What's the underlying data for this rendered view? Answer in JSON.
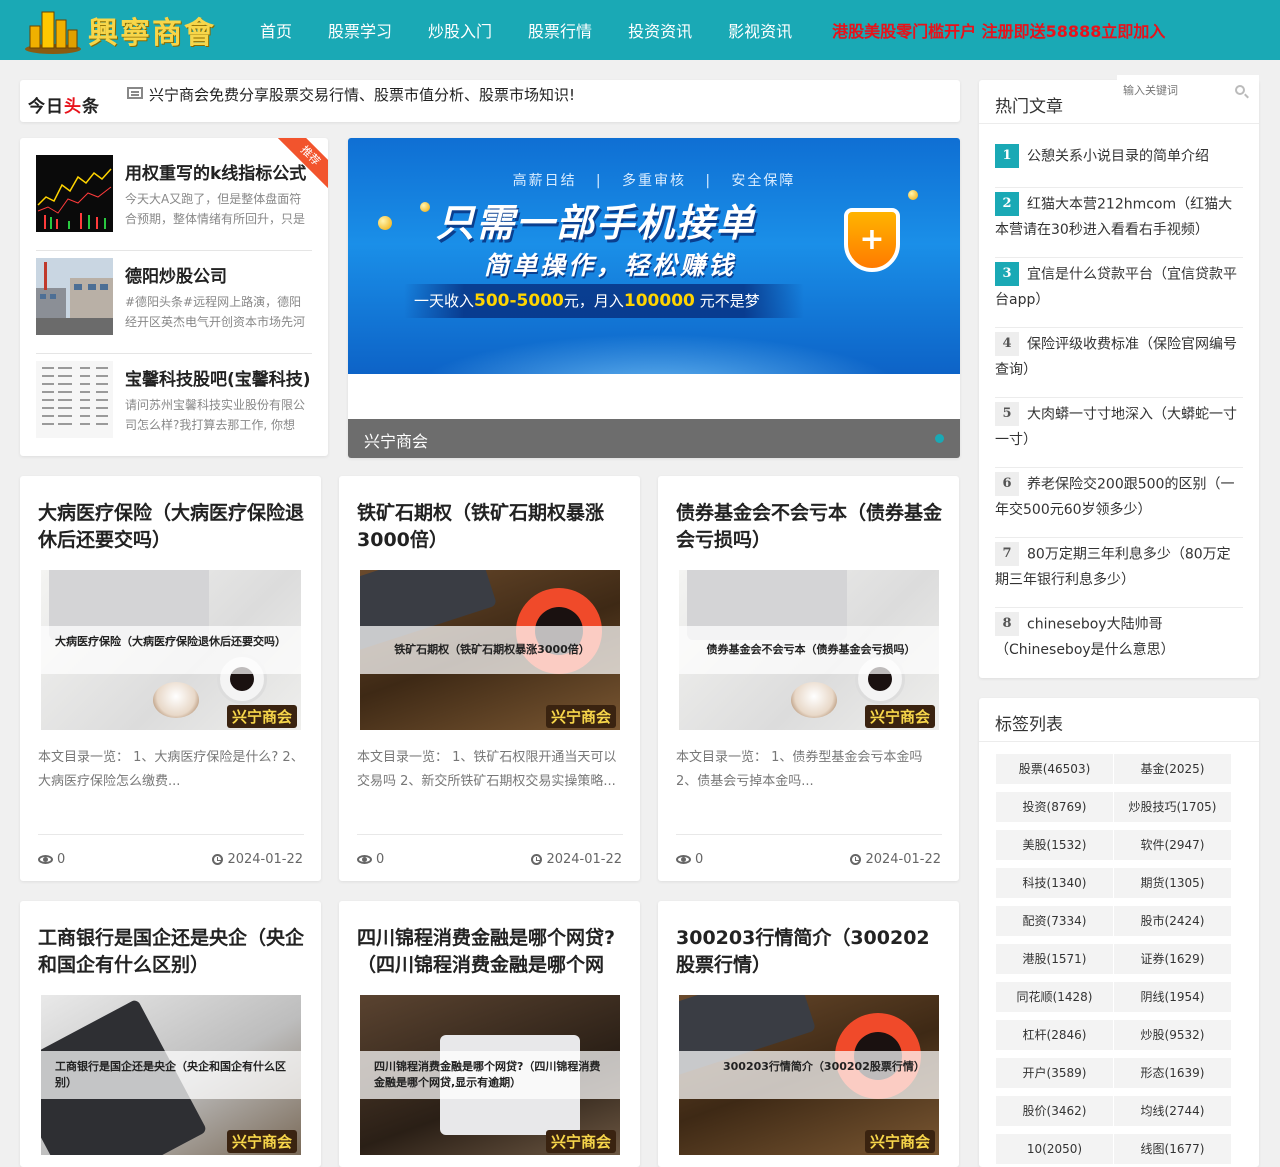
{
  "header": {
    "logo_text": "興寧商會",
    "nav": [
      "首页",
      "股票学习",
      "炒股入门",
      "股票行情",
      "投资资讯",
      "影视资讯"
    ],
    "promo": "港股美股零门槛开户 注册即送58888立即加入",
    "colors": {
      "bar": "#1aa9b5",
      "promo": "#e8121b",
      "logo": "#f7d64a"
    }
  },
  "headline": {
    "brand_black": "今日",
    "brand_red": "头",
    "brand_end": "条",
    "icon": "newspaper-icon",
    "text": "兴宁商会免费分享股票交易行情、股票市值分析、股票市场知识!"
  },
  "recommend": {
    "ribbon": "推荐",
    "items": [
      {
        "title": "用权重写的k线指标公式",
        "desc": "今天大A又跑了，但是整体盘面符合预期，整体情绪有所回升，只是"
      },
      {
        "title": "德阳炒股公司",
        "desc": "#德阳头条#远程网上路演，德阳经开区英杰电气开创资本市场先河"
      },
      {
        "title": "宝馨科技股吧(宝馨科技)",
        "desc": "请问苏州宝馨科技实业股份有限公司怎么样?我打算去那工作, 你想"
      }
    ]
  },
  "banner": {
    "top_line": "高薪日结   |   多重审核   |   安全保障",
    "main": "只需一部手机接单",
    "sub": "简单操作，轻松赚钱",
    "note_a": "一天收入",
    "note_b": "500-5000",
    "note_c": "元，月入",
    "note_d": "100000",
    "note_e": " 元不是梦",
    "caption": "兴宁商会"
  },
  "cards": [
    {
      "title": "大病医疗保险（大病医疗保险退休后还要交吗）",
      "overlay": "大病医疗保险（大病医疗保险退休后还要交吗）",
      "desc": "本文目录一览： 1、大病医疗保险是什么? 2、大病医疗保险怎么缴费...",
      "views": "0",
      "date": "2024-01-22",
      "badge": "兴宁商会"
    },
    {
      "title": "铁矿石期权（铁矿石期权暴涨3000倍）",
      "overlay": "铁矿石期权（铁矿石期权暴涨3000倍）",
      "desc": "本文目录一览： 1、铁矿石权限开通当天可以交易吗 2、新交所铁矿石期权交易实操策略...",
      "views": "0",
      "date": "2024-01-22",
      "badge": "兴宁商会"
    },
    {
      "title": "债券基金会不会亏本（债券基金会亏损吗）",
      "overlay": "债券基金会不会亏本（债券基金会亏损吗）",
      "desc": "本文目录一览： 1、债券型基金会亏本金吗 2、债基会亏掉本金吗...",
      "views": "0",
      "date": "2024-01-22",
      "badge": "兴宁商会"
    },
    {
      "title": "工商银行是国企还是央企（央企和国企有什么区别）",
      "overlay": "工商银行是国企还是央企（央企和国企有什么区别）",
      "badge": "兴宁商会"
    },
    {
      "title": "四川锦程消费金融是哪个网贷?（四川锦程消费金融是哪个网贷,",
      "overlay": "四川锦程消费金融是哪个网贷?（四川锦程消费金融是哪个网贷,显示有逾期）",
      "badge": "兴宁商会"
    },
    {
      "title": "300203行情简介（300202股票行情）",
      "overlay": "300203行情简介（300202股票行情）",
      "badge": "兴宁商会"
    }
  ],
  "sidebar": {
    "hot_title": "热门文章",
    "search_placeholder": "输入关键词",
    "hot": [
      {
        "num": "1",
        "text": "公憩关系小说目录的简单介绍"
      },
      {
        "num": "2",
        "text": "红猫大本营212hmcom（红猫大本营请在30秒进入看看右手视频）"
      },
      {
        "num": "3",
        "text": "宜信是什么贷款平台（宜信贷款平台app）"
      },
      {
        "num": "4",
        "text": "保险评级收费标准（保险官网编号查询）"
      },
      {
        "num": "5",
        "text": "大肉蟒一寸寸地深入（大蟒蛇一寸一寸）"
      },
      {
        "num": "6",
        "text": "养老保险交200跟500的区别（一年交500元60岁领多少）"
      },
      {
        "num": "7",
        "text": "80万定期三年利息多少（80万定期三年银行利息多少）"
      },
      {
        "num": "8",
        "text": "chineseboy大陆帅哥（Chineseboy是什么意思）"
      }
    ],
    "tags_title": "标签列表",
    "tags": [
      "股票(46503)",
      "基金(2025)",
      "投资(8769)",
      "炒股技巧(1705)",
      "美股(1532)",
      "软件(2947)",
      "科技(1340)",
      "期货(1305)",
      "配资(7334)",
      "股市(2424)",
      "港股(1571)",
      "证券(1629)",
      "同花顺(1428)",
      "阴线(1954)",
      "杠杆(2846)",
      "炒股(9532)",
      "开户(3589)",
      "形态(1639)",
      "股价(3462)",
      "均线(2744)",
      "10(2050)",
      "线图(1677)"
    ]
  }
}
